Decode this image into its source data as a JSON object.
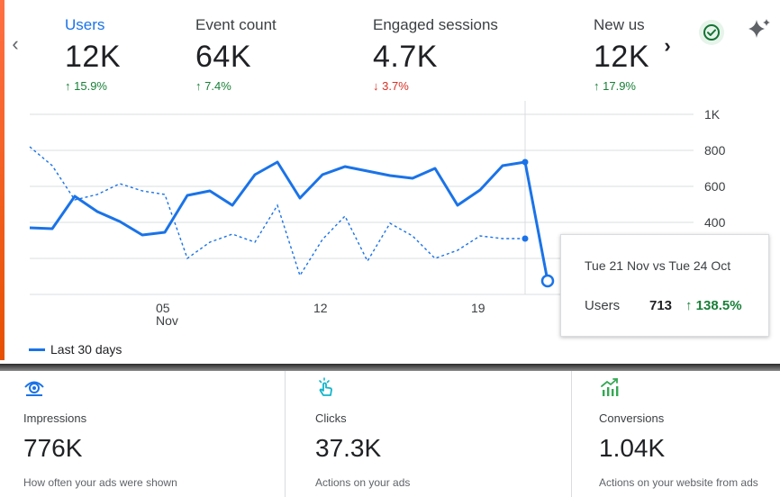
{
  "metrics": [
    {
      "label": "Users",
      "value": "12K",
      "change": "15.9%",
      "direction": "up"
    },
    {
      "label": "Event count",
      "value": "64K",
      "change": "7.4%",
      "direction": "up"
    },
    {
      "label": "Engaged sessions",
      "value": "4.7K",
      "change": "3.7%",
      "direction": "down"
    },
    {
      "label": "New us",
      "value": "12K",
      "change": "17.9%",
      "direction": "up"
    }
  ],
  "icons": {
    "prev": "chevron-left-icon",
    "next": "chevron-right-icon",
    "check": "check-circle-icon",
    "sparkle": "sparkle-icon"
  },
  "arrows": {
    "up": "↑",
    "down": "↓"
  },
  "colors": {
    "primary_series": "#1a73e8",
    "positive": "#188038",
    "negative": "#d93025"
  },
  "chart_data": {
    "type": "line",
    "x_ticks": [
      "05",
      "12",
      "19"
    ],
    "x_tick_sub": "Nov",
    "y_ticks": [
      "1K",
      "800",
      "600",
      "400"
    ],
    "ylim": [
      0,
      1000
    ],
    "legend": [
      "Last 30 days"
    ],
    "series": [
      {
        "name": "Last 30 days",
        "style": "solid",
        "values": [
          370,
          365,
          545,
          460,
          405,
          330,
          345,
          550,
          575,
          495,
          665,
          735,
          535,
          665,
          710,
          685,
          660,
          645,
          700,
          495,
          580,
          715,
          735,
          75
        ]
      },
      {
        "style": "dashed",
        "values": [
          820,
          715,
          525,
          555,
          615,
          575,
          555,
          200,
          290,
          335,
          290,
          495,
          105,
          305,
          435,
          185,
          395,
          325,
          200,
          245,
          325,
          310,
          310
        ]
      }
    ]
  },
  "tooltip": {
    "title": "Tue 21 Nov vs Tue 24 Oct",
    "metric": "Users",
    "value": "713",
    "change": "↑ 138.5%"
  },
  "ads_cards": [
    {
      "icon": "eye-icon",
      "label": "Impressions",
      "value": "776K",
      "description": "How often your ads were shown"
    },
    {
      "icon": "tap-icon",
      "label": "Clicks",
      "value": "37.3K",
      "description": "Actions on your ads"
    },
    {
      "icon": "trending-chart-icon",
      "label": "Conversions",
      "value": "1.04K",
      "description": "Actions on your website from ads"
    }
  ]
}
